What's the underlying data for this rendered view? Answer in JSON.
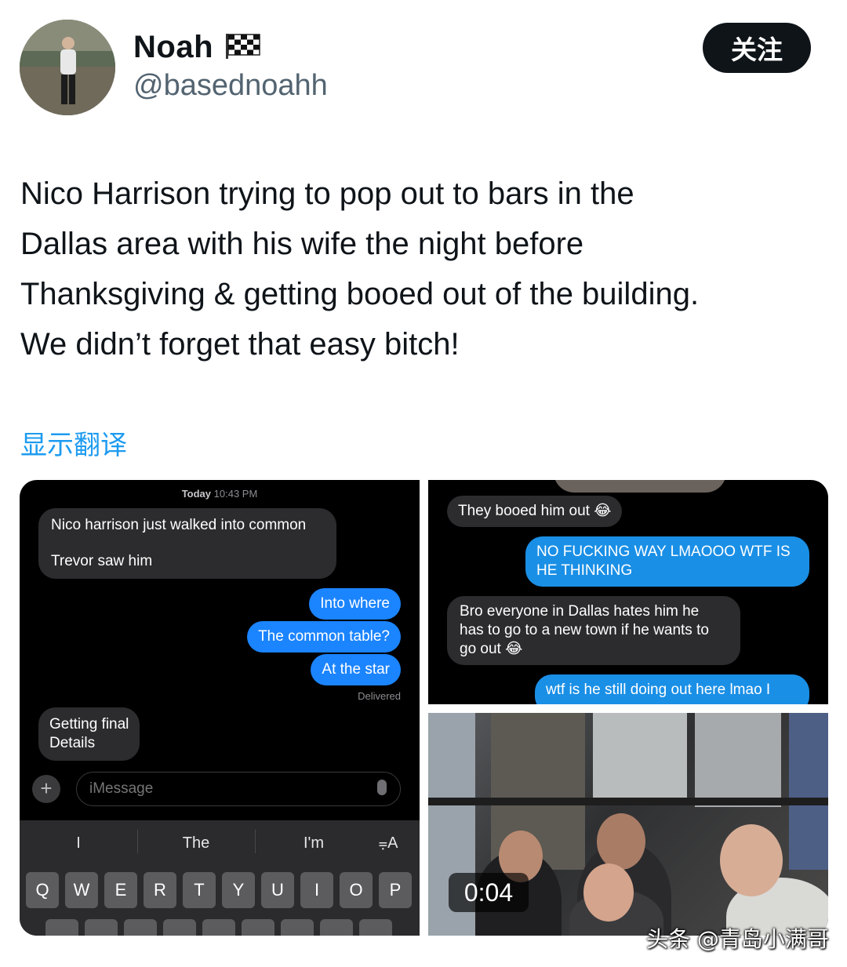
{
  "author": {
    "name": "Noah",
    "flag_emoji": "🏁",
    "handle": "@basednoahh"
  },
  "follow_label": "关注",
  "tweet": {
    "text_lines": [
      "Nico Harrison trying to pop out to bars in the",
      "Dallas area with his wife the night before",
      "Thanksgiving & getting booed out of the building.",
      "We didn’t forget that easy bitch!"
    ]
  },
  "translate_label": "显示翻译",
  "media": {
    "left_chat": {
      "timestamp_day": "Today",
      "timestamp_time": "10:43 PM",
      "incoming_1_line1": "Nico harrison just walked into common",
      "incoming_1_line2": "Trevor saw him",
      "outgoing_1": "Into where",
      "outgoing_2": "The common table?",
      "outgoing_3": "At the star",
      "delivered": "Delivered",
      "incoming_2_line1": "Getting final",
      "incoming_2_line2": "Details",
      "input_placeholder": "iMessage",
      "suggestions": [
        "I",
        "The",
        "I'm"
      ],
      "keys_row1": [
        "Q",
        "W",
        "E",
        "R",
        "T",
        "Y",
        "U",
        "I",
        "O",
        "P"
      ]
    },
    "right_chat": {
      "incoming_1": "They booed him out 😂",
      "outgoing_1_line1": "NO FUCKING WAY LMAOOO WTF IS",
      "outgoing_1_line2": "HE THINKING",
      "incoming_2_line1": "Bro everyone in Dallas hates him he",
      "incoming_2_line2": "has to go to a new town if he wants to",
      "incoming_2_line3": "go out 😂",
      "outgoing_2": "wtf is he still doing out here lmao I"
    },
    "video": {
      "duration": "0:04"
    }
  },
  "watermark": "头条 @青岛小满哥",
  "colors": {
    "link_blue": "#1d9bf0",
    "imessage_blue": "#1b84ff",
    "bubble_gray": "#2c2c2e"
  }
}
